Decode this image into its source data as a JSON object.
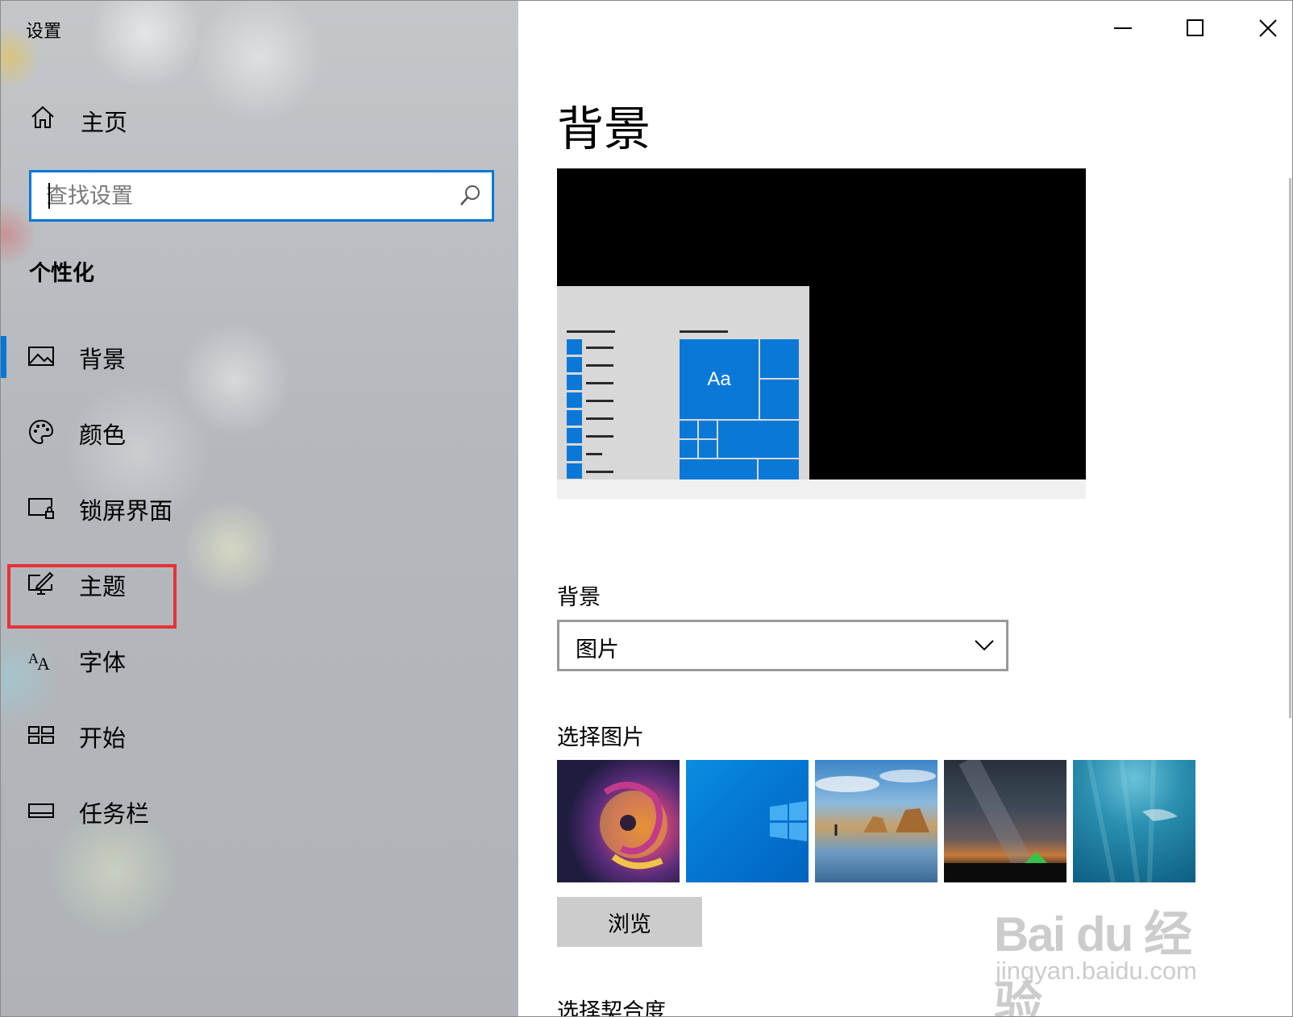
{
  "window": {
    "title": "设置"
  },
  "sidebar": {
    "home_label": "主页",
    "search": {
      "placeholder": "查找设置",
      "value": ""
    },
    "section_title": "个性化",
    "items": [
      {
        "label": "背景",
        "icon": "picture-icon",
        "active": true
      },
      {
        "label": "颜色",
        "icon": "palette-icon",
        "active": false
      },
      {
        "label": "锁屏界面",
        "icon": "lock-screen-icon",
        "active": false
      },
      {
        "label": "主题",
        "icon": "theme-icon",
        "active": false,
        "highlighted": true
      },
      {
        "label": "字体",
        "icon": "font-icon",
        "active": false
      },
      {
        "label": "开始",
        "icon": "start-icon",
        "active": false
      },
      {
        "label": "任务栏",
        "icon": "taskbar-icon",
        "active": false
      }
    ]
  },
  "main": {
    "page_title": "背景",
    "preview": {
      "sample_text": "Aa"
    },
    "background_label": "背景",
    "background_dropdown": {
      "selected": "图片"
    },
    "choose_picture_label": "选择图片",
    "browse_label": "浏览",
    "choose_fit_label": "选择契合度"
  },
  "watermark": {
    "logo_text": "Bai du 经验",
    "url_text": "jingyan.baidu.com"
  },
  "colors": {
    "accent": "#0078d7",
    "highlight_box": "#e63237",
    "browse_button": "#cccccc"
  }
}
